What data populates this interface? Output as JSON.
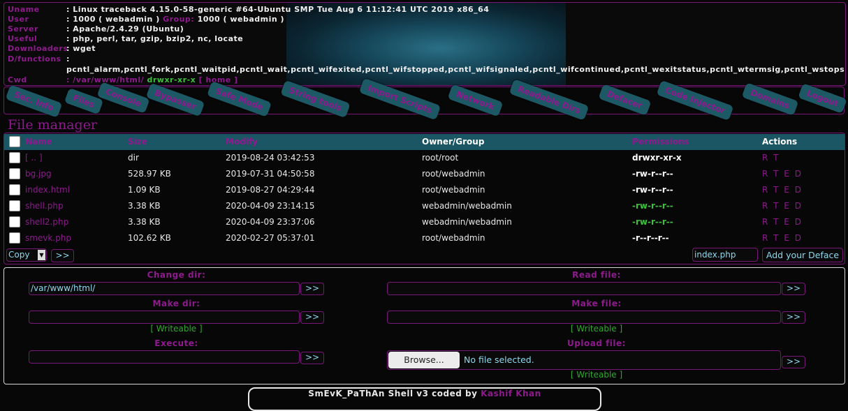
{
  "header": {
    "rows": [
      {
        "key": "Uname",
        "value": ": Linux traceback 4.15.0-58-generic #64-Ubuntu SMP Tue Aug 6 11:12:41 UTC 2019 x86_64"
      },
      {
        "key": "User",
        "value": ": 1000 ( webadmin )",
        "group_label": "Group:",
        "group_value": "1000 ( webadmin )"
      },
      {
        "key": "Server",
        "value": ": Apache/2.4.29 (Ubuntu)"
      },
      {
        "key": "Useful",
        "value": ": php, perl, tar, gzip, bzip2, nc, locate"
      },
      {
        "key": "Downloaders",
        "value": ": wget"
      },
      {
        "key": "D/functions",
        "value": ":"
      },
      {
        "key": "",
        "value": "pcntl_alarm,pcntl_fork,pcntl_waitpid,pcntl_wait,pcntl_wifexited,pcntl_wifstopped,pcntl_wifsignaled,pcntl_wifcontinued,pcntl_wexitstatus,pcntl_wtermsig,pcntl_wstopsig,pcntl_signa"
      },
      {
        "key": "Cwd",
        "value": ":",
        "path": "/var/www/html/",
        "perms": "drwxr-xr-x",
        "home": "[ home ]"
      }
    ]
  },
  "tabs": [
    "Sec. Info",
    "Files",
    "Console",
    "Bypasser",
    "Safe Mode",
    "String tools",
    "Import Scripts",
    "Network",
    "Readable Dirs",
    "Defacer",
    "Code Injector",
    "Domains",
    "Logout"
  ],
  "file_manager": {
    "title": "File manager",
    "columns": [
      "Name",
      "Size",
      "Modify",
      "Owner/Group",
      "Permissions",
      "Actions"
    ],
    "rows": [
      {
        "name": "[ .. ]",
        "size": "dir",
        "modify": "2019-08-24 03:42:53",
        "owner": "root/root",
        "perms": "drwxr-xr-x",
        "actions": "R T",
        "perm_color": "#ffffff"
      },
      {
        "name": "bg.jpg",
        "size": "528.97 KB",
        "modify": "2019-07-31 04:50:58",
        "owner": "root/webadmin",
        "perms": "-rw-r--r--",
        "actions": "R T E D",
        "perm_color": "#ffffff"
      },
      {
        "name": "index.html",
        "size": "1.09 KB",
        "modify": "2019-08-27 04:29:44",
        "owner": "root/webadmin",
        "perms": "-rw-r--r--",
        "actions": "R T E D",
        "perm_color": "#ffffff"
      },
      {
        "name": "shell.php",
        "size": "3.38 KB",
        "modify": "2020-04-09 23:14:15",
        "owner": "webadmin/webadmin",
        "perms": "-rw-r--r--",
        "actions": "R T E D",
        "perm_color": "#3fbf3f"
      },
      {
        "name": "shell2.php",
        "size": "3.38 KB",
        "modify": "2020-04-09 23:37:06",
        "owner": "webadmin/webadmin",
        "perms": "-rw-r--r--",
        "actions": "R T E D",
        "perm_color": "#3fbf3f"
      },
      {
        "name": "smevk.php",
        "size": "102.62 KB",
        "modify": "2020-02-27 05:37:01",
        "owner": "root/webadmin",
        "perms": "-r--r--r--",
        "actions": "R T E D",
        "perm_color": "#ffffff"
      }
    ],
    "bulk_action": "Copy",
    "go_label": ">>",
    "deface_file": "index.php",
    "deface_button": "Add your Deface"
  },
  "tools": {
    "change_dir": {
      "label": "Change dir:",
      "value": "/var/www/html/",
      "go": ">>"
    },
    "make_dir": {
      "label": "Make dir:",
      "value": "",
      "go": ">>",
      "status": "[ Writeable ]"
    },
    "execute": {
      "label": "Execute:",
      "value": "",
      "go": ">>"
    },
    "read_file": {
      "label": "Read file:",
      "value": "",
      "go": ">>"
    },
    "make_file": {
      "label": "Make file:",
      "value": "",
      "go": ">>",
      "status": "[ Writeable ]"
    },
    "upload_file": {
      "label": "Upload file:",
      "browse": "Browse...",
      "selected": "No file selected.",
      "go": ">>",
      "status": "[ Writeable ]"
    }
  },
  "footer": {
    "text": "SmEvK_PaThAn Shell v3 coded by",
    "author": "Kashif Khan"
  },
  "colors": {
    "accent": "#8e1a8e",
    "tab_bg": "#1d5865",
    "table_head": "#1b5664",
    "ok": "#3fbf3f"
  }
}
